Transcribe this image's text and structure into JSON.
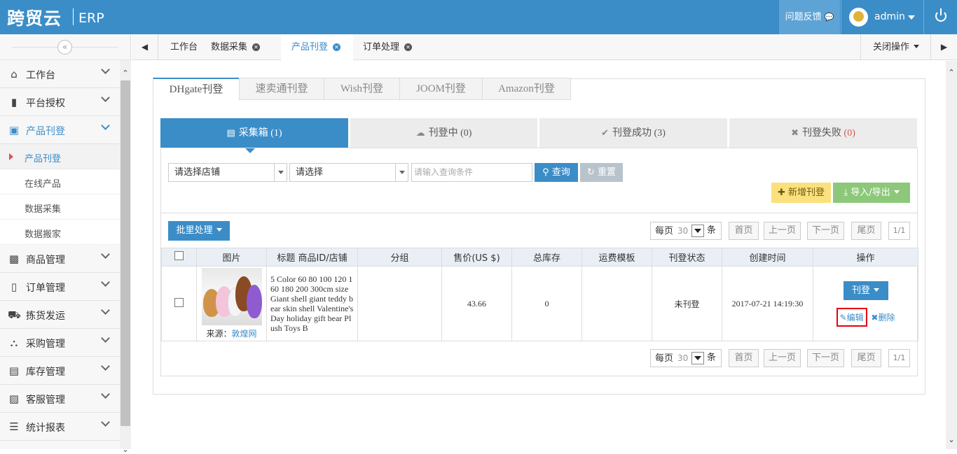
{
  "header": {
    "logo": "跨贸云",
    "product": "ERP",
    "feedback": "问题反馈",
    "username": "admin"
  },
  "sidebar": {
    "items": [
      {
        "label": "工作台",
        "icon": "home-icon"
      },
      {
        "label": "平台授权",
        "icon": "bookmark-icon"
      },
      {
        "label": "产品刊登",
        "icon": "cube-icon"
      },
      {
        "label": "商品管理",
        "icon": "gift-icon"
      },
      {
        "label": "订单管理",
        "icon": "file-icon"
      },
      {
        "label": "拣货发运",
        "icon": "truck-icon"
      },
      {
        "label": "采购管理",
        "icon": "cart-icon"
      },
      {
        "label": "库存管理",
        "icon": "inbox-icon"
      },
      {
        "label": "客服管理",
        "icon": "briefcase-icon"
      },
      {
        "label": "统计报表",
        "icon": "list-icon"
      }
    ],
    "subitems": [
      {
        "label": "产品刊登"
      },
      {
        "label": "在线产品"
      },
      {
        "label": "数据采集"
      },
      {
        "label": "数据搬家"
      }
    ]
  },
  "tabs": [
    {
      "label": "工作台"
    },
    {
      "label": "数据采集"
    },
    {
      "label": "产品刊登"
    },
    {
      "label": "订单处理"
    }
  ],
  "close_ops": "关闭操作",
  "platforms": [
    "DHgate刊登",
    "速卖通刊登",
    "Wish刊登",
    "JOOM刊登",
    "Amazon刊登"
  ],
  "status_tabs": [
    {
      "label": "采集箱",
      "count": "(1)"
    },
    {
      "label": "刊登中",
      "count": "(0)"
    },
    {
      "label": "刊登成功",
      "count": "(3)"
    },
    {
      "label": "刊登失败",
      "count": "(0)"
    }
  ],
  "filters": {
    "shop": "请选择店铺",
    "select": "请选择",
    "query_placeholder": "请输入查询条件",
    "query_btn": "查询",
    "reset_btn": "重置"
  },
  "actions": {
    "add": "新增刊登",
    "import_export": "导入/导出",
    "batch": "批里处理"
  },
  "pager": {
    "per_page": "每页",
    "size": "30",
    "unit": "条",
    "first": "首页",
    "prev": "上一页",
    "next": "下一页",
    "last": "尾页",
    "pages": "1/1"
  },
  "table": {
    "columns": [
      "图片",
      "标题 商品ID/店铺",
      "分组",
      "售价(US $)",
      "总库存",
      "运费模板",
      "刊登状态",
      "创建时间",
      "操作"
    ],
    "rows": [
      {
        "source_label": "来源：",
        "source": "敦煌网",
        "title": "5 Color 60 80 100 120 160 180 200 300cm size Giant shell giant teddy bear skin shell Valentine's Day holiday gift bear Plush Toys B",
        "group": "",
        "price": "43.66",
        "stock": "0",
        "shipping_template": "",
        "status": "未刊登",
        "created": "2017-07-21 14:19:30",
        "op_btn": "刊登",
        "edit": "编辑",
        "delete": "删除"
      }
    ]
  },
  "colors": {
    "primary": "#3b8dc8",
    "highlight": "#e60012"
  }
}
